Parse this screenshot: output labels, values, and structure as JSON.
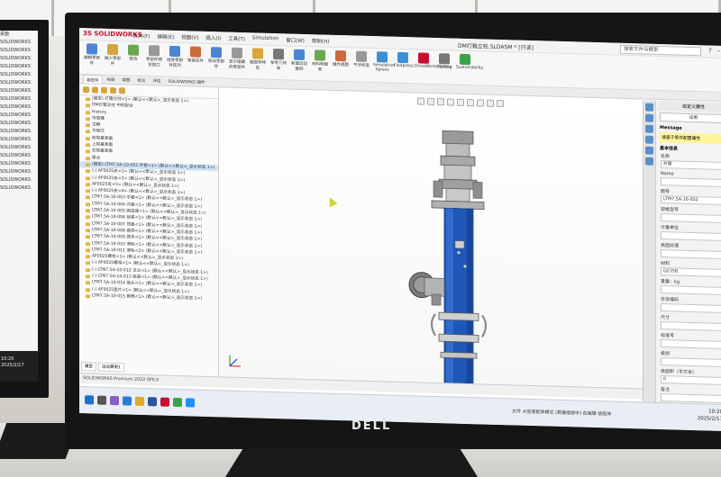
{
  "left_monitor": {
    "list_items": [
      "桌面",
      "SOLIDWORKS",
      "SOLIDWORKS",
      "SOLIDWORKS",
      "SOLIDWORKS",
      "SOLIDWORKS",
      "SOLIDWORKS",
      "SOLIDWORKS",
      "SOLIDWORKS",
      "SOLIDWORKS",
      "SOLIDWORKS",
      "SOLIDWORKS",
      "SOLIDWORKS",
      "SOLIDWORKS",
      "SOLIDWORKS",
      "SOLIDWORKS",
      "SOLIDWORKS",
      "SOLIDWORKS",
      "SOLIDWORKS",
      "SOLIDWORKS"
    ],
    "time": "10:20",
    "date": "2025/2/17"
  },
  "monitor": {
    "brand": "DELL"
  },
  "solidworks": {
    "logo": "3S SOLIDWORKS",
    "menu": [
      "文件(F)",
      "编辑(E)",
      "视图(V)",
      "插入(I)",
      "工具(T)",
      "Simulation",
      "窗口(W)",
      "帮助(H)"
    ],
    "doc_title": "DM灯箱立柱.SLDASM * [只读]",
    "search_placeholder": "搜索文件与模型",
    "ribbon_buttons": [
      "编辑零部件",
      "插入零部件",
      "配合",
      "零部件预览窗口",
      "线性零部件阵列",
      "智能扣件",
      "移动零部件",
      "显示隐藏的零部件",
      "装配体特征",
      "参考几何体",
      "新建运动算例",
      "材料明细表",
      "爆炸视图",
      "干涉检查",
      "Simulation Xpress",
      "FloXpress",
      "DriveWorksXpress",
      "Costing",
      "Sustainability"
    ],
    "command_tabs": [
      "装配体",
      "布局",
      "草图",
      "标注",
      "评估",
      "SOLIDWORKS 插件"
    ],
    "tree_items": [
      "(固定) 灯箱立柱<1> (默认<<默认>_显示状态 1>)",
      "DM灯箱立柱 中的配合",
      "History",
      "传感器",
      "注解",
      "方程式",
      "前视基准面",
      "上视基准面",
      "右视基准面",
      "原点",
      "(固定) LTM7.5A-10-002 外管<1> (默认<<默认>_显示状态 1>)",
      "(-) AF0025支<1> (默认<<默认>_显示状态 1>)",
      "(-) AF0025支<2> (默认<<默认>_显示状态 1>)",
      "AF0025支<3> (默认<<默认>_显示状态 1>)",
      "(-) AF0025支<4> (默认<<默认>_显示状态 1>)",
      "LTM7.5A-10-003 中管<1> (默认<<默认>_显示状态 1>)",
      "LTM7.5A-10-004 内管<1> (默认<<默认>_显示状态 1>)",
      "LTM7.5A-10-005 固定座<1> (默认<<默认>_显示状态 1>)",
      "LTM7.5A-10-006 锁紧<1> (默认<<默认>_显示状态 1>)",
      "LTM7.5A-10-007 顶盖<1> (默认<<默认>_显示状态 1>)",
      "LTM7.5A-10-008 卷扬<1> (默认<<默认>_显示状态 1>)",
      "LTM7.5A-10-009 把手<1> (默认<<默认>_显示状态 1>)",
      "LTM7.5A-10-010 滑轮<1> (默认<<默认>_显示状态 1>)",
      "LTM7.5A-10-011 滑轮<2> (默认<<默认>_显示状态 1>)",
      "AF0025螺栓<1> (默认<<默认>_显示状态 1>)",
      "(-) AF0025螺母<1> (默认<<默认>_显示状态 1>)",
      "(-) LTM7.5A-10-012 法兰<1> (默认<<默认>_显示状态 1>)",
      "(-) LTM7.5A-10-013 底座<1> (默认<<默认>_显示状态 1>)",
      "LTM7.5A-10-014 接头<1> (默认<<默认>_显示状态 1>)",
      "(-) AF0025垫片<1> (默认<<默认>_显示状态 1>)",
      "LTM7.5A-10-015 套筒<1> (默认<<默认>_显示状态 1>)"
    ],
    "tree_tabs": [
      "模型",
      "运动算例1"
    ],
    "status_text": "SOLIDWORKS Premium 2022 SP0.0",
    "properties": {
      "title": "自定义属性",
      "apply_label": "应用",
      "message_label": "Message",
      "message_text": "请基于零件配置属性",
      "section_label": "基本信息",
      "fields": [
        {
          "label": "名称",
          "value": "外管"
        },
        {
          "label": "Name",
          "value": ""
        },
        {
          "label": "图号",
          "value": "LTM7.5A-10-002"
        },
        {
          "label": "规格型号",
          "value": ""
        },
        {
          "label": "计量单位",
          "value": ""
        },
        {
          "label": "表面处理",
          "value": ""
        },
        {
          "label": "材料",
          "value": "Q235B"
        },
        {
          "label": "重量：kg",
          "value": ""
        },
        {
          "label": "存货编码",
          "value": ""
        },
        {
          "label": "尺寸",
          "value": ""
        },
        {
          "label": "标准号",
          "value": ""
        },
        {
          "label": "级别",
          "value": ""
        },
        {
          "label": "表面积（平方米）",
          "value": "0"
        },
        {
          "label": "备注",
          "value": ""
        }
      ],
      "more_label": "更多属性..."
    },
    "taskbar": {
      "status": "文件 大型装配体模式 (数据缩放中) 在编辑 装配体",
      "time": "10:20",
      "date": "2025/2/17"
    }
  }
}
